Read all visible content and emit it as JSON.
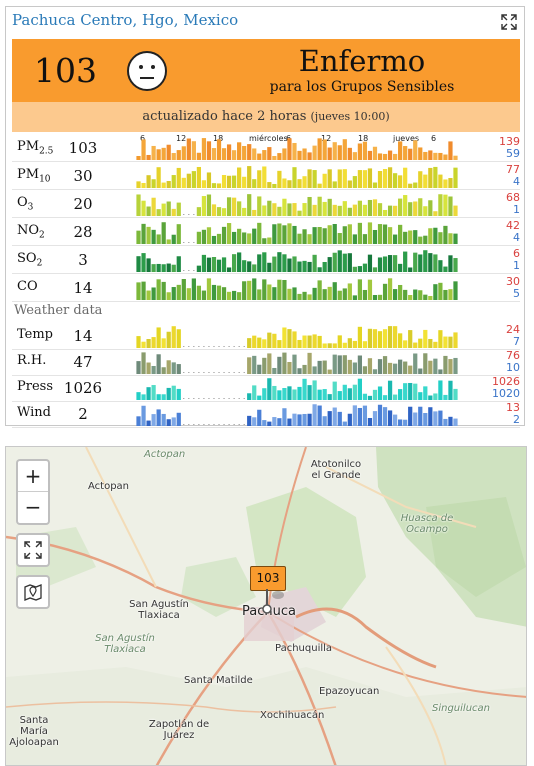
{
  "station": {
    "name": "Pachuca Centro, Hgo, Mexico"
  },
  "aqi": {
    "value": "103",
    "level": "Enfermo",
    "sublevel": "para los Grupos Sensibles",
    "color": "#f99b2e"
  },
  "updated": {
    "text": "actualizado hace 2 horas",
    "detail": "(jueves 10:00)"
  },
  "time_ticks": [
    "6",
    "12",
    "18",
    "miércoles",
    "6",
    "12",
    "18",
    "jueves",
    "6"
  ],
  "pollutants": [
    {
      "key": "pm25",
      "label": "PM",
      "sub": "2.5",
      "value": "103",
      "max": "139",
      "min": "59",
      "palette": "orange"
    },
    {
      "key": "pm10",
      "label": "PM",
      "sub": "10",
      "value": "30",
      "max": "77",
      "min": "4",
      "palette": "yellow"
    },
    {
      "key": "o3",
      "label": "O",
      "sub": "3",
      "value": "20",
      "max": "68",
      "min": "1",
      "palette": "greenyellow"
    },
    {
      "key": "no2",
      "label": "NO",
      "sub": "2",
      "value": "28",
      "max": "42",
      "min": "4",
      "palette": "green"
    },
    {
      "key": "so2",
      "label": "SO",
      "sub": "2",
      "value": "3",
      "max": "6",
      "min": "1",
      "palette": "darkgreen"
    },
    {
      "key": "co",
      "label": "CO",
      "sub": "",
      "value": "14",
      "max": "30",
      "min": "5",
      "palette": "green"
    }
  ],
  "weather_header": "Weather data",
  "weather": [
    {
      "key": "temp",
      "label": "Temp",
      "value": "14",
      "max": "24",
      "min": "7",
      "palette": "temp"
    },
    {
      "key": "rh",
      "label": "R.H.",
      "value": "47",
      "max": "76",
      "min": "10",
      "palette": "rh"
    },
    {
      "key": "press",
      "label": "Press",
      "value": "1026",
      "max": "1026",
      "min": "1020",
      "palette": "press"
    },
    {
      "key": "wind",
      "label": "Wind",
      "value": "2",
      "max": "13",
      "min": "2",
      "palette": "wind"
    }
  ],
  "map": {
    "zoom_in": "+",
    "zoom_out": "−",
    "marker_value": "103",
    "places": [
      {
        "name": "Actopan",
        "style": "normal"
      },
      {
        "name": "Actopan",
        "style": "small"
      },
      {
        "name": "Atotonilco el Grande",
        "style": "normal"
      },
      {
        "name": "Huasca de Ocampo",
        "style": "italic"
      },
      {
        "name": "San Agustín Tlaxiaca",
        "style": "normal"
      },
      {
        "name": "San Agustín Tlaxiaca",
        "style": "italic"
      },
      {
        "name": "Pachuca",
        "style": "big"
      },
      {
        "name": "Pachuquilla",
        "style": "normal"
      },
      {
        "name": "Santa Matilde",
        "style": "normal"
      },
      {
        "name": "Epazoyucan",
        "style": "normal"
      },
      {
        "name": "Zapotlán de Juárez",
        "style": "normal"
      },
      {
        "name": "Xochihuacán",
        "style": "normal"
      },
      {
        "name": "Singuilucan",
        "style": "italic"
      },
      {
        "name": "Santa María Ajoloapan",
        "style": "normal"
      }
    ]
  },
  "palette": {
    "accent": "#f99b2e",
    "link": "#2a7ab8",
    "max": "#d9413e",
    "min": "#3a74c8"
  }
}
